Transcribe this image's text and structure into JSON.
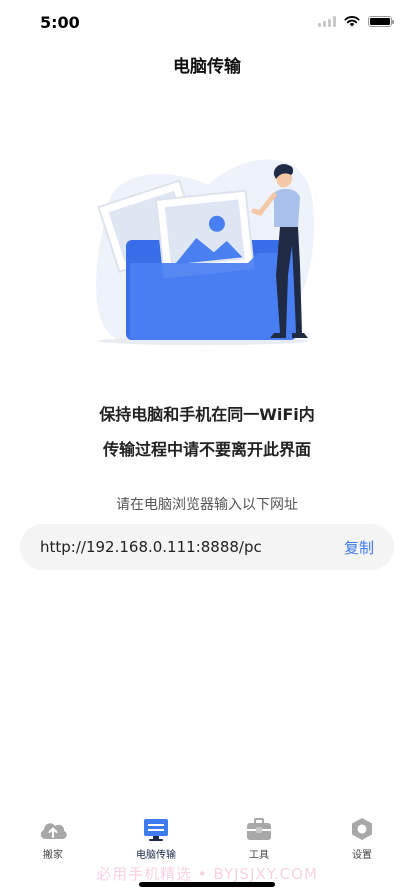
{
  "status_bar": {
    "time": "5:00"
  },
  "nav": {
    "title": "电脑传输"
  },
  "content": {
    "line1": "保持电脑和手机在同一WiFi内",
    "line2": "传输过程中请不要离开此界面",
    "hint": "请在电脑浏览器输入以下网址",
    "url": "http://192.168.0.111:8888/pc",
    "copy_label": "复制"
  },
  "tabs": [
    {
      "label": "搬家",
      "icon": "cloud-upload-icon",
      "active": false
    },
    {
      "label": "电脑传输",
      "icon": "monitor-icon",
      "active": true
    },
    {
      "label": "工具",
      "icon": "toolbox-icon",
      "active": false
    },
    {
      "label": "设置",
      "icon": "gear-icon",
      "active": false
    }
  ],
  "watermark": "必用手机精选 • BYJSJXY.COM",
  "colors": {
    "accent": "#3f7bf0",
    "folder_blue": "#4a7ff2",
    "tab_inactive": "#a8a8a8",
    "tab_active": "#1d2b4a"
  }
}
